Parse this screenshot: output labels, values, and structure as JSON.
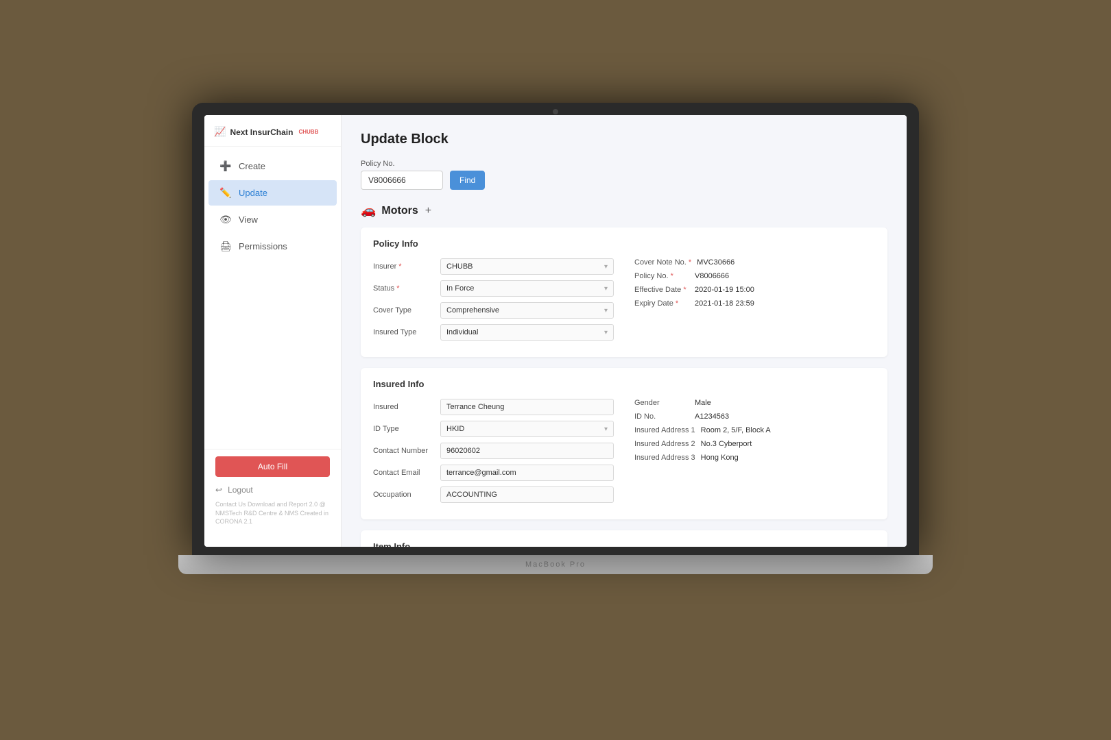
{
  "app": {
    "logo_text": "Next InsurChain",
    "logo_badge": "CHUBB",
    "brand_label": "MacBook Pro"
  },
  "sidebar": {
    "nav_items": [
      {
        "id": "create",
        "label": "Create",
        "icon": "➕",
        "active": false
      },
      {
        "id": "update",
        "label": "Update",
        "icon": "✏️",
        "active": true
      },
      {
        "id": "view",
        "label": "View",
        "icon": "👁",
        "active": false
      },
      {
        "id": "permissions",
        "label": "Permissions",
        "icon": "🖨",
        "active": false
      }
    ],
    "auto_fill_label": "Auto Fill",
    "logout_label": "Logout",
    "copyright": "Contact Us\nDownload and Report 2.0 @ NMSTech R&D Centre & NMS\nCreated in CORONA 2.1"
  },
  "main": {
    "page_title": "Update Block",
    "policy_search": {
      "label": "Policy No.",
      "value": "V8006666",
      "find_btn": "Find"
    },
    "motors_section": {
      "icon": "🚗",
      "title": "Motors",
      "add_symbol": "+"
    },
    "policy_info": {
      "card_title": "Policy Info",
      "fields_left": [
        {
          "label": "Insurer",
          "required": true,
          "value": "CHUBB",
          "type": "select"
        },
        {
          "label": "Status",
          "required": true,
          "value": "In Force",
          "type": "select"
        },
        {
          "label": "Cover Type",
          "required": false,
          "value": "Comprehensive",
          "type": "select"
        },
        {
          "label": "Insured Type",
          "required": false,
          "value": "Individual",
          "type": "select"
        }
      ],
      "fields_right": [
        {
          "label": "Cover Note No.",
          "required": true,
          "value": "MVC30666"
        },
        {
          "label": "Policy No.",
          "required": true,
          "value": "V8006666"
        },
        {
          "label": "Effective Date",
          "required": true,
          "value": "2020-01-19 15:00"
        },
        {
          "label": "Expiry Date",
          "required": true,
          "value": "2021-01-18 23:59"
        }
      ]
    },
    "insured_info": {
      "card_title": "Insured Info",
      "fields_left": [
        {
          "label": "Insured",
          "required": false,
          "value": "Terrance Cheung",
          "type": "input"
        },
        {
          "label": "ID Type",
          "required": false,
          "value": "HKID",
          "type": "select"
        },
        {
          "label": "Contact Number",
          "required": false,
          "value": "96020602",
          "type": "input"
        },
        {
          "label": "Contact Email",
          "required": false,
          "value": "terrance@gmail.com",
          "type": "input"
        },
        {
          "label": "Occupation",
          "required": false,
          "value": "ACCOUNTING",
          "type": "input"
        }
      ],
      "fields_right": [
        {
          "label": "Gender",
          "value": "Male"
        },
        {
          "label": "ID No.",
          "value": "A1234563"
        },
        {
          "label": "Insured Address 1",
          "value": "Room 2, 5/F, Block A"
        },
        {
          "label": "Insured Address 2",
          "value": "No.3 Cyberport"
        },
        {
          "label": "Insured Address 3",
          "value": "Hong Kong"
        }
      ]
    },
    "item_info": {
      "card_title": "Item Info"
    }
  }
}
